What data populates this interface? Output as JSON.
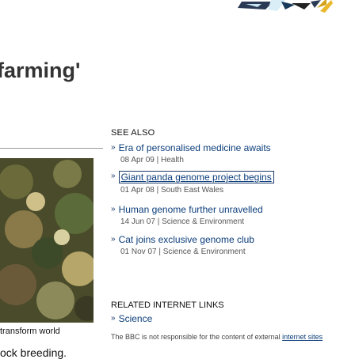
{
  "article": {
    "headline": "farming'",
    "photo_caption": "transform world",
    "body_fragment": "ock breeding."
  },
  "see_also": {
    "heading": "SEE ALSO",
    "stories": [
      {
        "title": "Era of personalised medicine awaits",
        "date": "08 Apr 09",
        "section": "Health"
      },
      {
        "title": "Giant panda genome project begins",
        "date": "01 Apr 08",
        "section": "South East Wales"
      },
      {
        "title": "Human genome further unravelled",
        "date": "14 Jun 07",
        "section": "Science & Environment"
      },
      {
        "title": "Cat joins exclusive genome club",
        "date": "01 Nov 07",
        "section": "Science & Environment"
      }
    ]
  },
  "related_links": {
    "heading": "RELATED INTERNET LINKS",
    "items": [
      {
        "title": "Science"
      }
    ],
    "disclaimer_prefix": "The BBC is not responsible for the content of external ",
    "disclaimer_link": "internet sites"
  },
  "colors": {
    "link": "#0b3d7a",
    "meta": "#555555",
    "heading": "#333333"
  }
}
